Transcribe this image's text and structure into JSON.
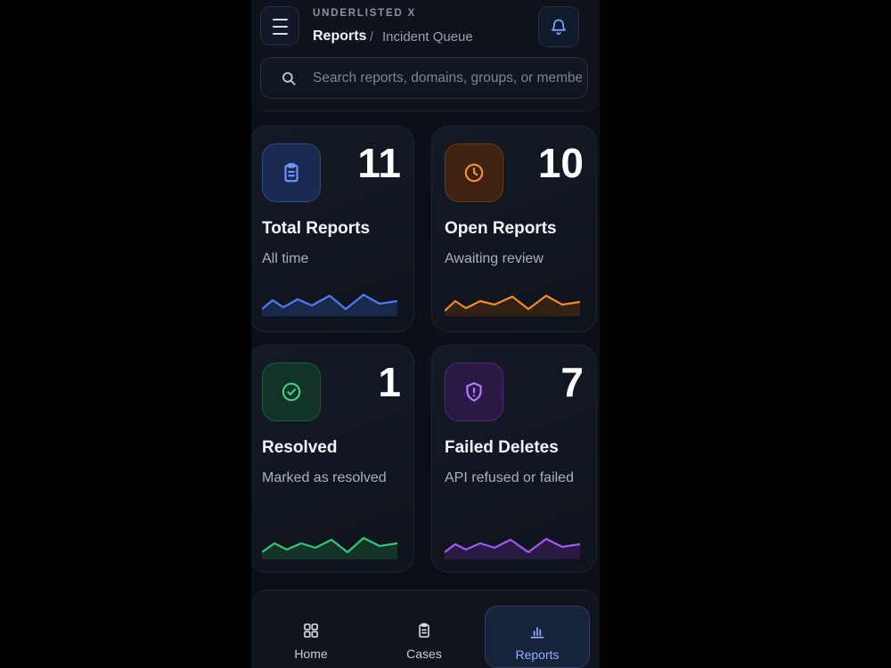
{
  "header": {
    "brand": "UNDERLISTED X",
    "breadcrumb_main": "Reports",
    "breadcrumb_sep": "/",
    "breadcrumb_sub": "Incident Queue",
    "menu_icon": "hamburger-icon",
    "notification_icon": "bell-icon"
  },
  "search": {
    "placeholder": "Search reports, domains, groups, or members",
    "value": "",
    "icon": "search-icon"
  },
  "stats": [
    {
      "title": "Total Reports",
      "subtitle": "All time",
      "value": "11",
      "icon": "clipboard-icon",
      "accent": "#4f7cf0"
    },
    {
      "title": "Open Reports",
      "subtitle": "Awaiting review",
      "value": "10",
      "icon": "clock-icon",
      "accent": "#f08a2c"
    },
    {
      "title": "Resolved",
      "subtitle": "Marked as resolved",
      "value": "1",
      "icon": "check-circle-icon",
      "accent": "#35c47a"
    },
    {
      "title": "Failed Deletes",
      "subtitle": "API refused or failed",
      "value": "7",
      "icon": "shield-alert-icon",
      "accent": "#a25cf0"
    }
  ],
  "nav": {
    "items": [
      {
        "label": "Home",
        "icon": "grid-icon",
        "active": false
      },
      {
        "label": "Cases",
        "icon": "clipboard-icon",
        "active": false
      },
      {
        "label": "Reports",
        "icon": "bar-chart-icon",
        "active": true
      }
    ]
  }
}
